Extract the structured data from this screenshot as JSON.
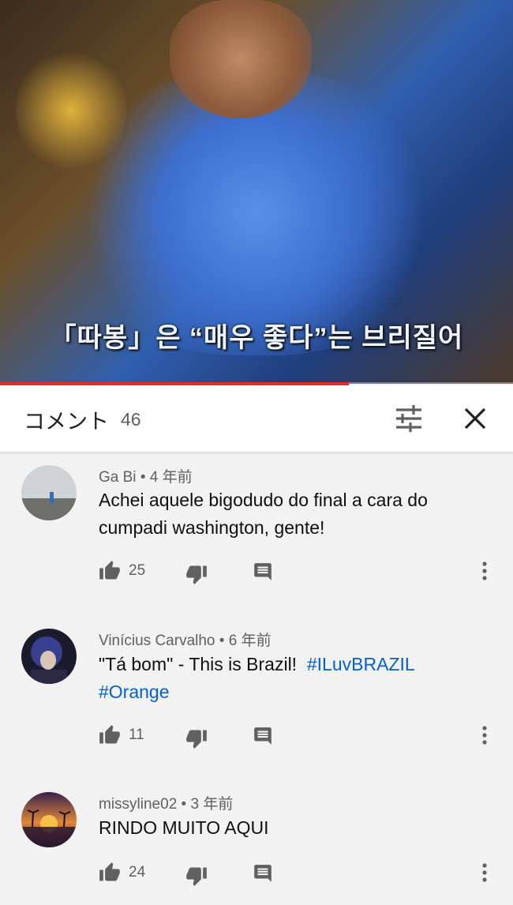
{
  "video": {
    "subtitle": "「따봉」은 “매우 좋다”는 브리질어",
    "progress_fraction": 0.68
  },
  "comments_header": {
    "title": "コメント",
    "count": "46",
    "icons": {
      "filter": "sort-filter-icon",
      "close": "close-icon"
    }
  },
  "comments": [
    {
      "author": "Ga Bi",
      "separator": "•",
      "time": "4 年前",
      "text": "Achei aquele bigodudo do final a cara do cumpadi washington, gente!",
      "likes": "25",
      "avatar": "foggy-landscape-avatar"
    },
    {
      "author": "Vinícius Carvalho",
      "separator": "•",
      "time": "6 年前",
      "text_before": "\"Tá bom\" - This is Brazil!",
      "hashtags": [
        "#ILuvBRAZIL",
        "#Orange"
      ],
      "likes": "11",
      "avatar": "anime-character-avatar"
    },
    {
      "author": "missyline02",
      "separator": "•",
      "time": "3 年前",
      "text": "RINDO MUITO AQUI",
      "likes": "24",
      "avatar": "sunset-palm-trees-avatar"
    }
  ],
  "action_icons": {
    "like": "thumbs-up-icon",
    "dislike": "thumbs-down-icon",
    "reply": "reply-comment-icon",
    "more": "more-vertical-icon"
  },
  "colors": {
    "hashtag": "#065fd4",
    "progress": "#e52d27",
    "meta_text": "#606060"
  }
}
